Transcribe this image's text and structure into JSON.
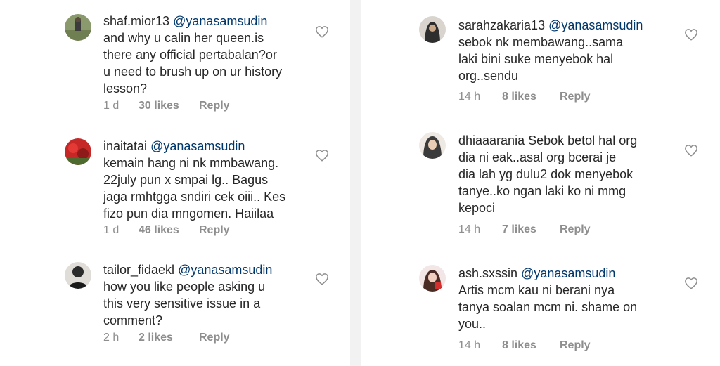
{
  "comments_left": [
    {
      "username": "shaf.mior13",
      "mention": "@yanasamsudin",
      "lines": [
        "and why u calin her queen.is",
        "there any official pertabalan?or",
        "u need to brush up on ur history",
        "lesson?"
      ],
      "time": "1 d",
      "likes": "30 likes",
      "reply": "Reply"
    },
    {
      "username": "inaitatai",
      "mention": "@yanasamsudin",
      "lines": [
        "kemain hang ni nk mmbawang.",
        "22july pun x smpai lg.. Bagus",
        "jaga rmhtgga sndiri cek oiii.. Kes",
        "fizo pun dia mngomen. Haiilaa"
      ],
      "time": "1 d",
      "likes": "46 likes",
      "reply": "Reply"
    },
    {
      "username": "tailor_fidaekl",
      "mention": "@yanasamsudin",
      "lines": [
        "how you like people asking u",
        "this very sensitive issue in a",
        "comment?"
      ],
      "time": "2 h",
      "likes": "2 likes",
      "reply": "Reply"
    }
  ],
  "comments_right": [
    {
      "username": "sarahzakaria13",
      "mention": "@yanasamsudin",
      "lines": [
        "sebok nk membawang..sama",
        "laki bini suke menyebok hal",
        "org..sendu"
      ],
      "time": "14 h",
      "likes": "8 likes",
      "reply": "Reply"
    },
    {
      "username": "dhiaaarania",
      "first_line_rest": "Sebok betol hal org",
      "lines": [
        "dia  ni eak..asal org bcerai je",
        "dia lah yg dulu2 dok menyebok",
        "tanye..ko ngan laki ko ni mmg",
        "kepoci"
      ],
      "time": "14 h",
      "likes": "7 likes",
      "reply": "Reply"
    },
    {
      "username": "ash.sxssin",
      "mention": "@yanasamsudin",
      "lines": [
        "Artis mcm kau ni berani nya",
        "tanya soalan mcm ni. shame on",
        "you.."
      ],
      "time": "14 h",
      "likes": "8 likes",
      "reply": "Reply"
    }
  ],
  "icons": {
    "like": "heart-outline-icon",
    "avatar": "avatar"
  },
  "colors": {
    "text": "#262626",
    "mention": "#00376b",
    "meta": "#8e8e8e",
    "divider": "#f2f2f2"
  }
}
